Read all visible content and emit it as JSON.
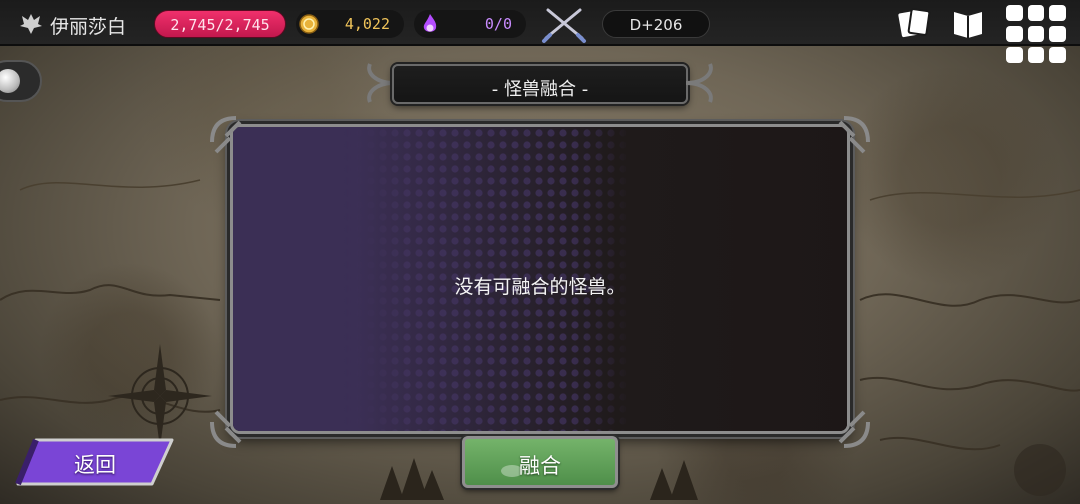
{
  "player": {
    "name": "伊丽莎白",
    "hp": "2,745/2,745",
    "gold": "4,022",
    "souls": "0/0",
    "day": "D+206"
  },
  "icons": {
    "player_emblem": "winged-crest-icon",
    "coin": "gold-coin-icon",
    "soul": "soul-flame-icon",
    "battle": "crossed-swords-icon",
    "cards": "cards-icon",
    "book": "book-icon",
    "menu": "menu-grid-icon"
  },
  "dialog": {
    "title": "- 怪兽融合 -",
    "empty_message": "没有可融合的怪兽。"
  },
  "buttons": {
    "back": "返回",
    "fuse": "融合"
  },
  "colors": {
    "hp_pill": "#e02560",
    "gold_text": "#f0c45a",
    "soul_text": "#c98cff",
    "back_button": "#7a45d6",
    "fuse_button": "#62a25b",
    "panel_purple": "#3b2f55"
  }
}
